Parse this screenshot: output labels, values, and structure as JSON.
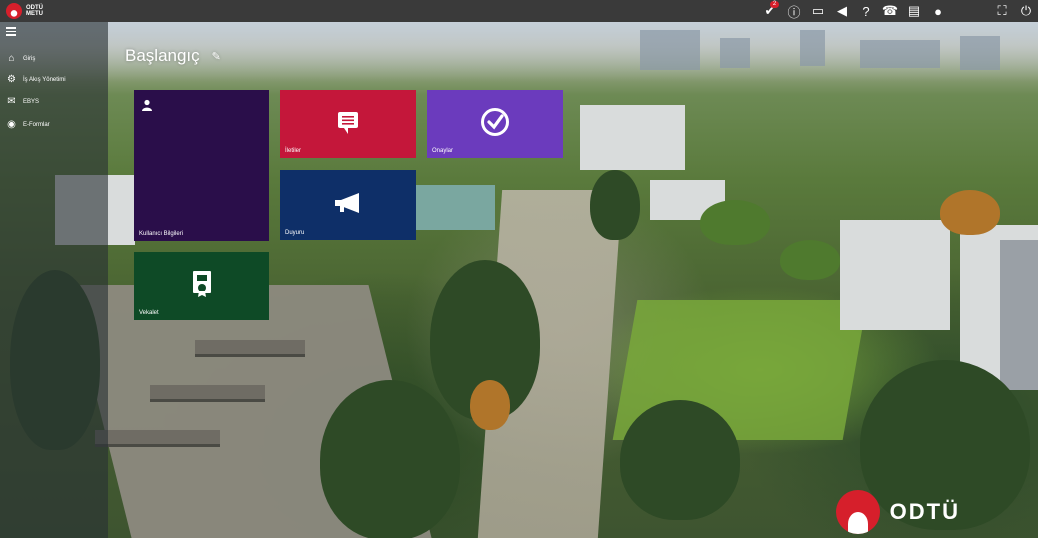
{
  "brand": {
    "name_line1": "ODTÜ",
    "name_line2": "METU"
  },
  "topbar": {
    "icons": [
      {
        "name": "approvals-icon",
        "glyph": "✔",
        "badge": "2"
      },
      {
        "name": "info-icon",
        "glyph": "ⓘ"
      },
      {
        "name": "messages-icon",
        "glyph": "▭"
      },
      {
        "name": "announcement-icon",
        "glyph": "◀"
      },
      {
        "name": "help-icon",
        "glyph": "?"
      },
      {
        "name": "phone-icon",
        "glyph": "☎"
      },
      {
        "name": "document-icon",
        "glyph": "▤"
      },
      {
        "name": "user-icon",
        "glyph": "●"
      },
      {
        "name": "fullscreen-icon",
        "glyph": "⛶"
      },
      {
        "name": "power-icon",
        "glyph": "⏻"
      }
    ]
  },
  "sidebar": {
    "items": [
      {
        "label": "Giriş",
        "icon": "home-icon",
        "glyph": "⌂"
      },
      {
        "label": "İş Akış Yönetimi",
        "icon": "workflow-icon",
        "glyph": "⚙"
      },
      {
        "label": "EBYS",
        "icon": "ebys-icon",
        "glyph": "✉"
      },
      {
        "label": "E-Formlar",
        "icon": "eforms-icon",
        "glyph": "◉"
      }
    ]
  },
  "page": {
    "title": "Başlangıç"
  },
  "tiles": [
    {
      "name": "user-info",
      "label": "Kullanıcı Bilgileri",
      "color": "#2a0e4a",
      "icon": "user-icon"
    },
    {
      "name": "messages",
      "label": "İletiler",
      "color": "#c4173a",
      "icon": "message-icon"
    },
    {
      "name": "approvals",
      "label": "Onaylar",
      "color": "#6b3bbd",
      "icon": "check-circle-icon"
    },
    {
      "name": "announcement",
      "label": "Duyuru",
      "color": "#0e2f68",
      "icon": "megaphone-icon"
    },
    {
      "name": "proxy",
      "label": "Vekalet",
      "color": "#0e4a26",
      "icon": "certificate-icon"
    }
  ],
  "footer": {
    "logo_text": "ODTÜ"
  }
}
